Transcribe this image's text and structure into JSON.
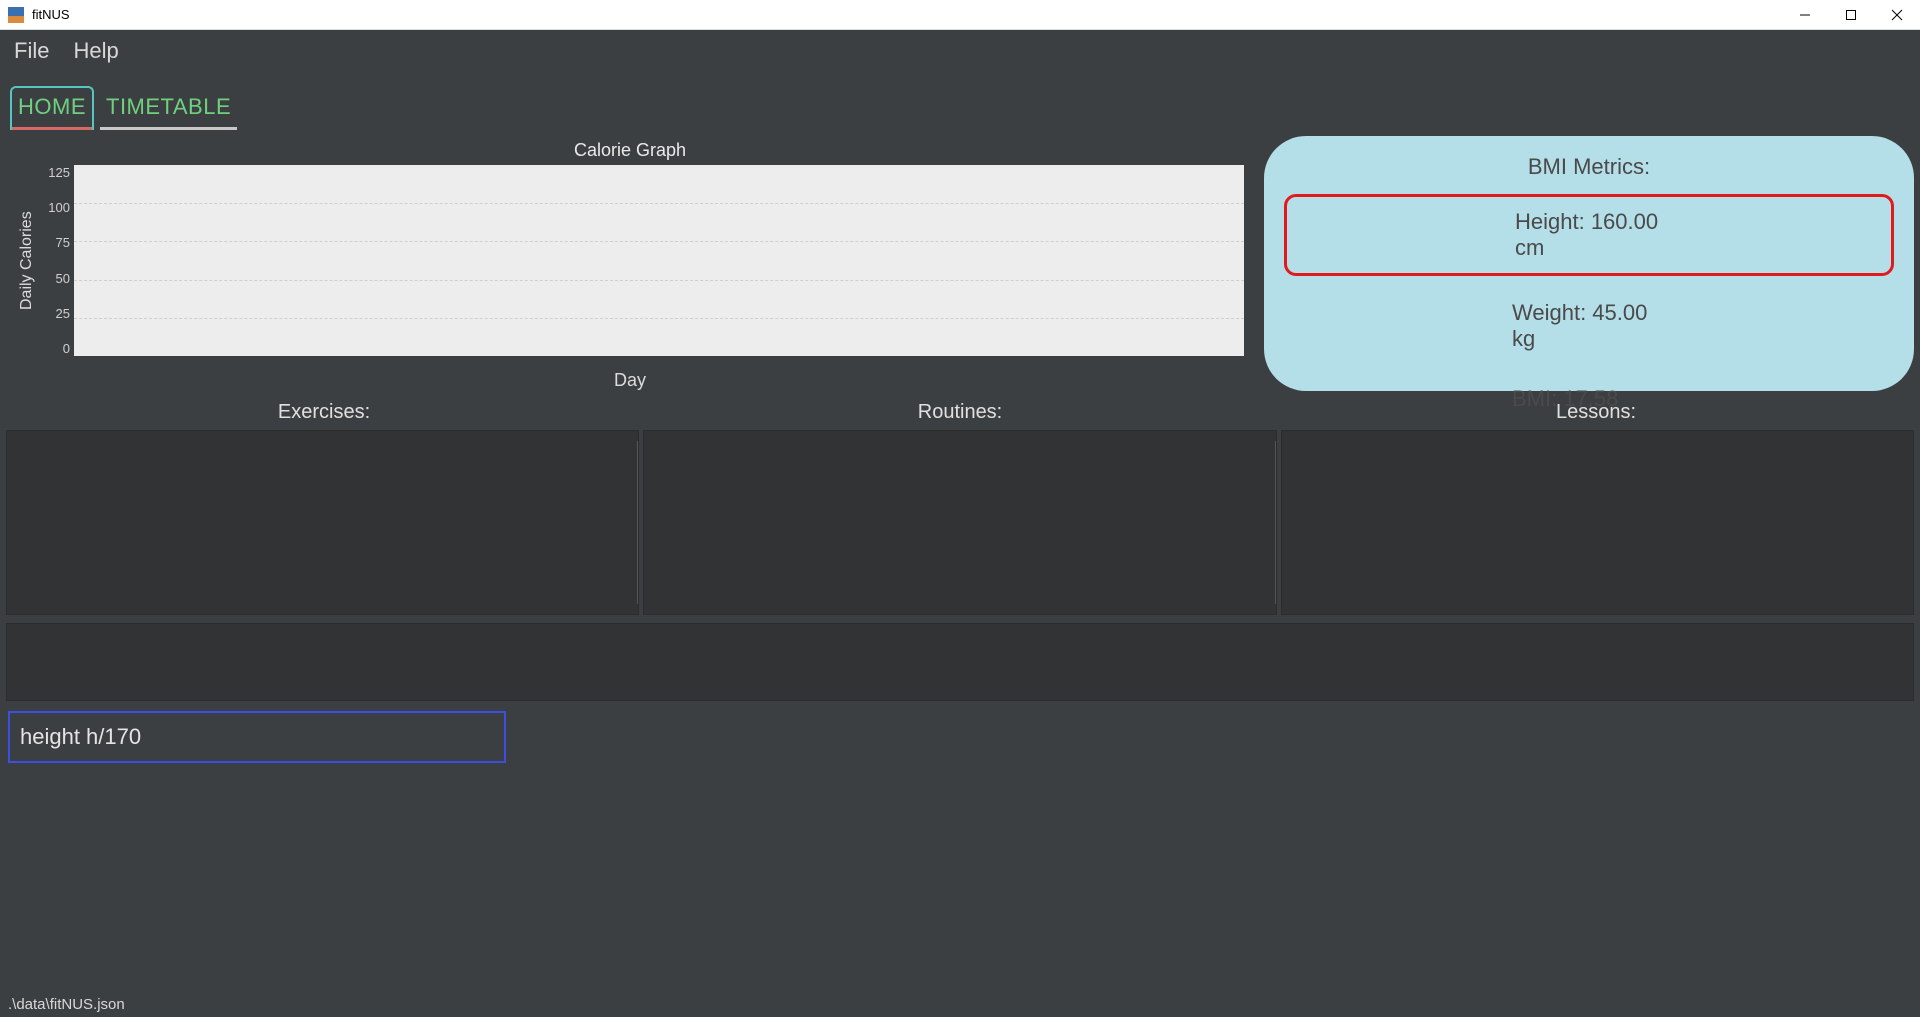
{
  "window": {
    "title": "fitNUS"
  },
  "menu": {
    "file": "File",
    "help": "Help"
  },
  "tabs": {
    "home": "HOME",
    "timetable": "TIMETABLE"
  },
  "chart_data": {
    "type": "bar",
    "title": "Calorie Graph",
    "xlabel": "Day",
    "ylabel": "Daily Calories",
    "categories": [],
    "values": [],
    "y_ticks": [
      0,
      25,
      50,
      75,
      100,
      125
    ],
    "ylim": [
      0,
      125
    ]
  },
  "bmi": {
    "title": "BMI Metrics:",
    "height_label": "Height: 160.00 cm",
    "weight_label": "Weight: 45.00 kg",
    "bmi_label": "BMI: 17.58"
  },
  "sections": {
    "exercises": "Exercises:",
    "routines": "Routines:",
    "lessons": "Lessons:"
  },
  "command": {
    "value": "height h/170"
  },
  "status": {
    "path": ".\\data\\fitNUS.json"
  }
}
